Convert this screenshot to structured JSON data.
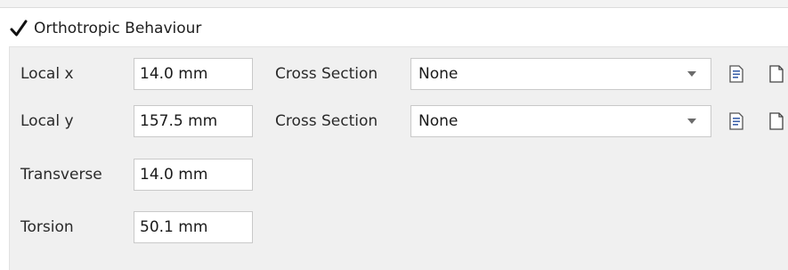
{
  "header": {
    "checked": true,
    "label": "Orthotropic Behaviour"
  },
  "rows": [
    {
      "label": "Local x",
      "value": "14.0 mm",
      "cross_section_label": "Cross Section",
      "cross_section_value": "None"
    },
    {
      "label": "Local y",
      "value": "157.5 mm",
      "cross_section_label": "Cross Section",
      "cross_section_value": "None"
    },
    {
      "label": "Transverse",
      "value": "14.0 mm"
    },
    {
      "label": "Torsion",
      "value": "50.1 mm"
    }
  ],
  "icons": {
    "edit": "edit-document-icon",
    "new": "new-document-icon"
  },
  "colors": {
    "panel_bg": "#f0f0f0",
    "field_border": "#c9c9c9",
    "icon_accent": "#3a5fa8"
  }
}
